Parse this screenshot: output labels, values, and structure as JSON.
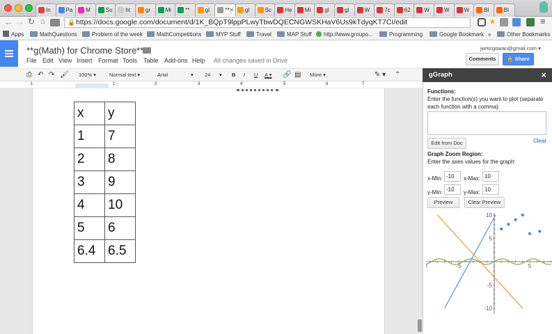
{
  "browser": {
    "tabs": [
      "In",
      "Pa",
      "M",
      "Su",
      "ht",
      "gr",
      "Mi",
      "**",
      "gl",
      "**",
      "gl",
      "Sc",
      "He",
      "Mi",
      "gl",
      "gl",
      "W",
      "7c",
      "62",
      "W",
      "W",
      "W",
      "Bl",
      "Bl"
    ],
    "active_tab_index": 9,
    "url": "https://docs.google.com/document/d/1K_BQpT9lppPLwyTbwDQECNGWSKHaV6Us9kTdyqKT7CI/edit",
    "bookmarks": [
      "Apps",
      "MathQuestions",
      "Problem of the week",
      "MathCompetitions",
      "MYP Stuff",
      "Travel",
      "MAP Stuff",
      "http://www.groupo...",
      "Programming",
      "Google Bookmark"
    ],
    "bookmarks_more": "»",
    "other_bookmarks": "Other Bookmarks"
  },
  "doc": {
    "title": "**g(Math) for Chrome Store**",
    "user_email": "jwmcgowan@gmail.com",
    "comments_label": "Comments",
    "share_label": "Share",
    "menus": [
      "File",
      "Edit",
      "View",
      "Insert",
      "Format",
      "Tools",
      "Table",
      "Add-ons",
      "Help"
    ],
    "save_status": "All changes saved in Drive",
    "toolbar": {
      "zoom": "100%",
      "style": "Normal text",
      "font": "Arial",
      "size": "24",
      "more": "More"
    },
    "ruler_marks": [
      "1",
      "1",
      "2",
      "3",
      "4",
      "5",
      "6",
      "7"
    ],
    "table": {
      "headers": [
        "x",
        "y"
      ],
      "rows": [
        [
          "1",
          "7"
        ],
        [
          "2",
          "8"
        ],
        [
          "3",
          "9"
        ],
        [
          "4",
          "10"
        ],
        [
          "5",
          "6"
        ],
        [
          "6.4",
          "6.5"
        ]
      ]
    }
  },
  "sidebar": {
    "title": "gGraph",
    "close": "×",
    "functions_heading": "Functions:",
    "functions_desc_1": "Enter the function(s) you want to plot (separate",
    "functions_desc_2": "each function with a comma):",
    "functions_value": "",
    "edit_from_doc": "Edit from Doc",
    "clear": "Clear",
    "zoom_heading": "Graph Zoom Region:",
    "zoom_desc": "Enter the axes values for the graph:",
    "xmin_label": "x-Min:",
    "xmin": "-10",
    "xmax_label": "x-Max:",
    "xmax": "10",
    "ymin_label": "y-Min:",
    "ymin": "-10",
    "ymax_label": "y-Max:",
    "ymax": "10",
    "preview": "Preview",
    "clear_preview": "Clear Preview"
  },
  "chart_data": {
    "type": "scatter",
    "xlim": [
      -10,
      10
    ],
    "ylim": [
      -10,
      10
    ],
    "x_tick_labels": [
      "-10",
      "-5",
      "5"
    ],
    "y_tick_labels": [
      "10",
      "5",
      "-5",
      "-10"
    ],
    "points": [
      [
        1,
        7
      ],
      [
        2,
        8
      ],
      [
        3,
        9
      ],
      [
        4,
        10
      ],
      [
        5,
        6
      ],
      [
        6.4,
        6.5
      ]
    ],
    "lines": [
      {
        "color": "#5b8fd0",
        "x": [
          -7,
          0.2
        ],
        "y": [
          -10,
          10
        ]
      },
      {
        "color": "#e29a3c",
        "x": [
          -8,
          4
        ],
        "y": [
          10,
          -10
        ]
      }
    ],
    "wave": {
      "color": "#8fae4b",
      "amplitude": 0.6,
      "period": 4.4
    },
    "colors": {
      "points": "#4a7ec4"
    }
  }
}
